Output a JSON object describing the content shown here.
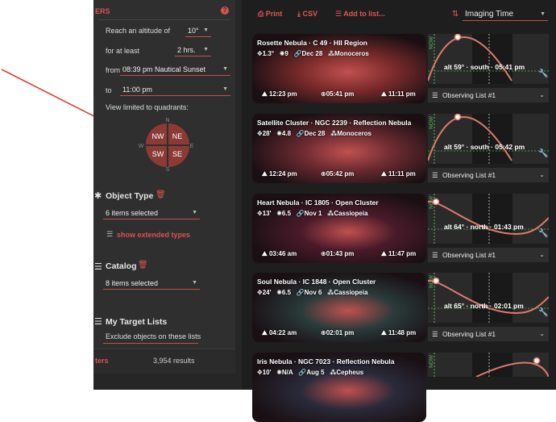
{
  "sidebar": {
    "header": "ERS",
    "help_icon": "question-circle-icon",
    "altitude_label": "Reach an altitude of",
    "altitude_value": "10°",
    "duration_label": "for at least",
    "duration_value": "2 hrs.",
    "from_label": "from",
    "from_value": "08:39 pm Nautical Sunset",
    "to_label": "to",
    "to_value": "11:00 pm",
    "quadrant_label": "View limited to quadrants:",
    "quadrants": {
      "n": "N",
      "s": "S",
      "e": "E",
      "w": "W",
      "nw": "NW",
      "ne": "NE",
      "sw": "SW",
      "se": "SE"
    },
    "object_type_title": "Object Type",
    "object_type_value": "6 items selected",
    "extended_types_link": "show extended types",
    "catalog_title": "Catalog",
    "catalog_value": "8 items selected",
    "target_lists_title": "My Target Lists",
    "target_lists_desc": "Exclude objects on these lists",
    "footer_left": "ters",
    "footer_results": "3,954 results"
  },
  "toolbar": {
    "print_label": "Print",
    "csv_label": "CSV",
    "add_label": "Add to list...",
    "sort_value": "Imaging Time"
  },
  "colors": {
    "accent": "#d9534f",
    "curve": "#e07a6a",
    "quad_fill": "#8b3a35"
  },
  "objects": [
    {
      "title": "Rosette Nebula · C 49 · HII Region",
      "size": "1.3°",
      "mag": "9",
      "date": "Dec 28",
      "constellation": "Monoceros",
      "rise": "12:23 pm",
      "transit": "05:41 pm",
      "set": "11:11 pm",
      "alt": "alt 59° · south · 05:41 pm",
      "list": "Observing List #1"
    },
    {
      "title": "Satellite Cluster · NGC 2239 · Reflection Nebula",
      "size": "28'",
      "mag": "4.8",
      "date": "Dec 28",
      "constellation": "Monoceros",
      "rise": "12:24 pm",
      "transit": "05:42 pm",
      "set": "11:11 pm",
      "alt": "alt 59° · south · 05:42 pm",
      "list": "Observing List #1"
    },
    {
      "title": "Heart Nebula · IC 1805 · Open Cluster",
      "size": "13'",
      "mag": "6.5",
      "date": "Nov 1",
      "constellation": "Cassiopeia",
      "rise": "03:46 am",
      "transit": "01:43 pm",
      "set": "11:47 pm",
      "alt": "alt 64° · north · 01:43 pm",
      "list": "Observing List #1"
    },
    {
      "title": "Soul Nebula · IC 1848 · Open Cluster",
      "size": "24'",
      "mag": "6.5",
      "date": "Nov 6",
      "constellation": "Cassiopeia",
      "rise": "04:22 am",
      "transit": "02:01 pm",
      "set": "11:48 pm",
      "alt": "alt 65° · north · 02:01 pm",
      "list": "Observing List #1"
    },
    {
      "title": "Iris Nebula · NGC 7023 · Reflection Nebula",
      "size": "10'",
      "mag": "N/A",
      "date": "Aug 5",
      "constellation": "Cepheus"
    }
  ],
  "chart_vertical_label": "NOW"
}
